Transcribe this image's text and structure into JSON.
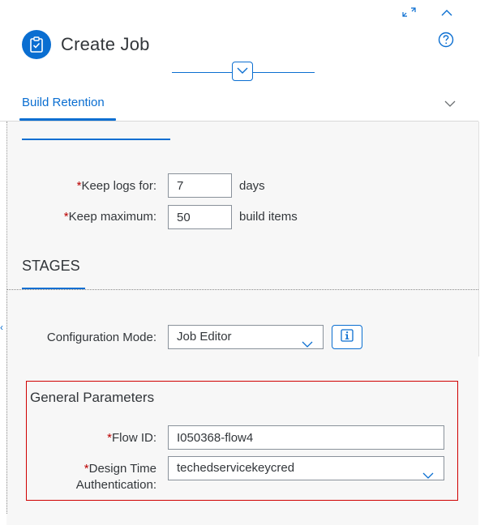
{
  "dialog": {
    "title": "Create Job",
    "icons": {
      "job": "clipboard-check-icon",
      "help": "question-circle-icon",
      "exit_fullscreen": "exit-fullscreen-icon",
      "collapse_header": "chevron-up-icon",
      "toggle_header": "chevron-down-icon"
    }
  },
  "tab": {
    "label": "Build Retention",
    "expand_icon": "chevron-down-icon"
  },
  "build_retention": {
    "keep_logs": {
      "required": "*",
      "label": "Keep logs for:",
      "value": "7",
      "unit": "days"
    },
    "keep_max": {
      "required": "*",
      "label": "Keep maximum:",
      "value": "50",
      "unit": "build items"
    }
  },
  "stages": {
    "title": "STAGES",
    "config_mode": {
      "label": "Configuration Mode:",
      "value": "Job Editor",
      "info_icon": "info-icon"
    },
    "general_parameters": {
      "title": "General Parameters",
      "flow_id": {
        "required": "*",
        "label": "Flow ID:",
        "value": "I050368-flow4"
      },
      "design_auth": {
        "required": "*",
        "label_line1": "Design Time",
        "label_line2": "Authentication:",
        "value": "techedservicekeycred"
      }
    }
  },
  "colors": {
    "accent": "#0a6ed1",
    "required": "#bb0000",
    "highlight_border": "#d00000",
    "content_bg": "#f7f7f7"
  }
}
